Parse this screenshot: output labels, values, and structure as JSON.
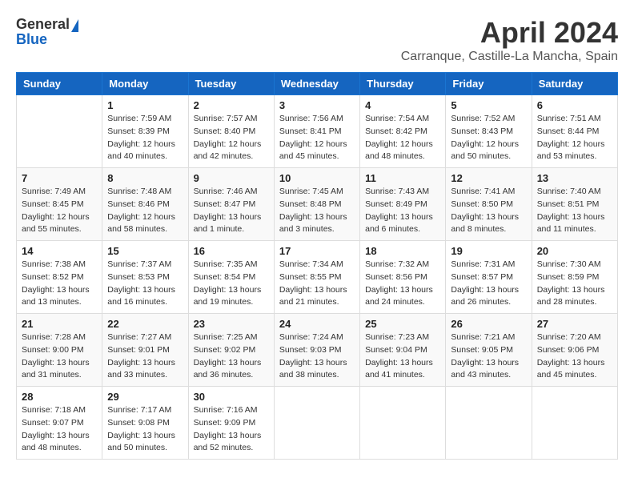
{
  "header": {
    "logo_general": "General",
    "logo_blue": "Blue",
    "title": "April 2024",
    "subtitle": "Carranque, Castille-La Mancha, Spain"
  },
  "calendar": {
    "headers": [
      "Sunday",
      "Monday",
      "Tuesday",
      "Wednesday",
      "Thursday",
      "Friday",
      "Saturday"
    ],
    "weeks": [
      [
        {
          "day": "",
          "info": ""
        },
        {
          "day": "1",
          "info": "Sunrise: 7:59 AM\nSunset: 8:39 PM\nDaylight: 12 hours\nand 40 minutes."
        },
        {
          "day": "2",
          "info": "Sunrise: 7:57 AM\nSunset: 8:40 PM\nDaylight: 12 hours\nand 42 minutes."
        },
        {
          "day": "3",
          "info": "Sunrise: 7:56 AM\nSunset: 8:41 PM\nDaylight: 12 hours\nand 45 minutes."
        },
        {
          "day": "4",
          "info": "Sunrise: 7:54 AM\nSunset: 8:42 PM\nDaylight: 12 hours\nand 48 minutes."
        },
        {
          "day": "5",
          "info": "Sunrise: 7:52 AM\nSunset: 8:43 PM\nDaylight: 12 hours\nand 50 minutes."
        },
        {
          "day": "6",
          "info": "Sunrise: 7:51 AM\nSunset: 8:44 PM\nDaylight: 12 hours\nand 53 minutes."
        }
      ],
      [
        {
          "day": "7",
          "info": "Sunrise: 7:49 AM\nSunset: 8:45 PM\nDaylight: 12 hours\nand 55 minutes."
        },
        {
          "day": "8",
          "info": "Sunrise: 7:48 AM\nSunset: 8:46 PM\nDaylight: 12 hours\nand 58 minutes."
        },
        {
          "day": "9",
          "info": "Sunrise: 7:46 AM\nSunset: 8:47 PM\nDaylight: 13 hours\nand 1 minute."
        },
        {
          "day": "10",
          "info": "Sunrise: 7:45 AM\nSunset: 8:48 PM\nDaylight: 13 hours\nand 3 minutes."
        },
        {
          "day": "11",
          "info": "Sunrise: 7:43 AM\nSunset: 8:49 PM\nDaylight: 13 hours\nand 6 minutes."
        },
        {
          "day": "12",
          "info": "Sunrise: 7:41 AM\nSunset: 8:50 PM\nDaylight: 13 hours\nand 8 minutes."
        },
        {
          "day": "13",
          "info": "Sunrise: 7:40 AM\nSunset: 8:51 PM\nDaylight: 13 hours\nand 11 minutes."
        }
      ],
      [
        {
          "day": "14",
          "info": "Sunrise: 7:38 AM\nSunset: 8:52 PM\nDaylight: 13 hours\nand 13 minutes."
        },
        {
          "day": "15",
          "info": "Sunrise: 7:37 AM\nSunset: 8:53 PM\nDaylight: 13 hours\nand 16 minutes."
        },
        {
          "day": "16",
          "info": "Sunrise: 7:35 AM\nSunset: 8:54 PM\nDaylight: 13 hours\nand 19 minutes."
        },
        {
          "day": "17",
          "info": "Sunrise: 7:34 AM\nSunset: 8:55 PM\nDaylight: 13 hours\nand 21 minutes."
        },
        {
          "day": "18",
          "info": "Sunrise: 7:32 AM\nSunset: 8:56 PM\nDaylight: 13 hours\nand 24 minutes."
        },
        {
          "day": "19",
          "info": "Sunrise: 7:31 AM\nSunset: 8:57 PM\nDaylight: 13 hours\nand 26 minutes."
        },
        {
          "day": "20",
          "info": "Sunrise: 7:30 AM\nSunset: 8:59 PM\nDaylight: 13 hours\nand 28 minutes."
        }
      ],
      [
        {
          "day": "21",
          "info": "Sunrise: 7:28 AM\nSunset: 9:00 PM\nDaylight: 13 hours\nand 31 minutes."
        },
        {
          "day": "22",
          "info": "Sunrise: 7:27 AM\nSunset: 9:01 PM\nDaylight: 13 hours\nand 33 minutes."
        },
        {
          "day": "23",
          "info": "Sunrise: 7:25 AM\nSunset: 9:02 PM\nDaylight: 13 hours\nand 36 minutes."
        },
        {
          "day": "24",
          "info": "Sunrise: 7:24 AM\nSunset: 9:03 PM\nDaylight: 13 hours\nand 38 minutes."
        },
        {
          "day": "25",
          "info": "Sunrise: 7:23 AM\nSunset: 9:04 PM\nDaylight: 13 hours\nand 41 minutes."
        },
        {
          "day": "26",
          "info": "Sunrise: 7:21 AM\nSunset: 9:05 PM\nDaylight: 13 hours\nand 43 minutes."
        },
        {
          "day": "27",
          "info": "Sunrise: 7:20 AM\nSunset: 9:06 PM\nDaylight: 13 hours\nand 45 minutes."
        }
      ],
      [
        {
          "day": "28",
          "info": "Sunrise: 7:18 AM\nSunset: 9:07 PM\nDaylight: 13 hours\nand 48 minutes."
        },
        {
          "day": "29",
          "info": "Sunrise: 7:17 AM\nSunset: 9:08 PM\nDaylight: 13 hours\nand 50 minutes."
        },
        {
          "day": "30",
          "info": "Sunrise: 7:16 AM\nSunset: 9:09 PM\nDaylight: 13 hours\nand 52 minutes."
        },
        {
          "day": "",
          "info": ""
        },
        {
          "day": "",
          "info": ""
        },
        {
          "day": "",
          "info": ""
        },
        {
          "day": "",
          "info": ""
        }
      ]
    ]
  }
}
